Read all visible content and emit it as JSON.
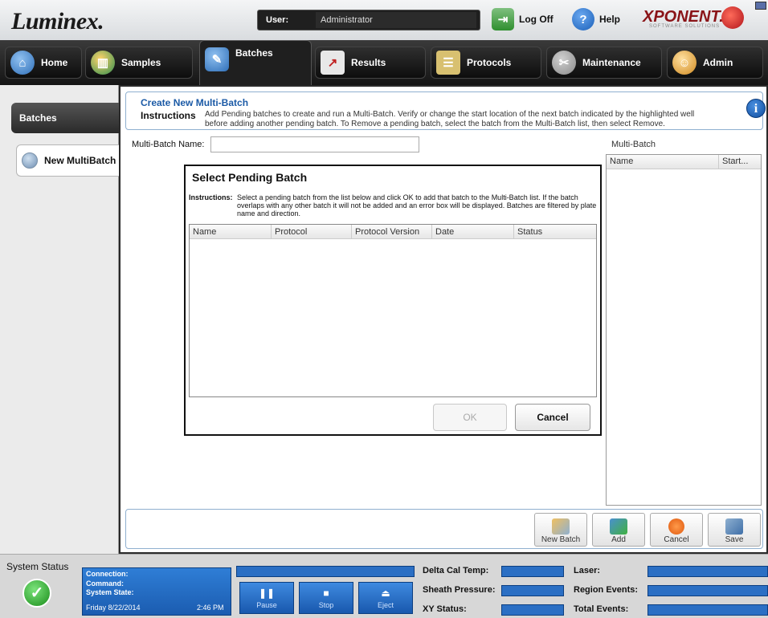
{
  "header": {
    "logo": "Luminex.",
    "user_label": "User:",
    "user_value": "Administrator",
    "logoff_label": "Log Off",
    "help_label": "Help",
    "brand": "XPONENT.",
    "brand_sub": "SOFTWARE SOLUTIONS"
  },
  "nav": {
    "tabs": [
      {
        "label": "Home",
        "icon": "home-icon"
      },
      {
        "label": "Samples",
        "icon": "samples-icon"
      },
      {
        "label": "Batches",
        "icon": "batches-icon"
      },
      {
        "label": "Results",
        "icon": "results-icon"
      },
      {
        "label": "Protocols",
        "icon": "protocols-icon"
      },
      {
        "label": "Maintenance",
        "icon": "maintenance-icon"
      },
      {
        "label": "Admin",
        "icon": "admin-icon"
      }
    ],
    "active": "Batches"
  },
  "left": {
    "section": "Batches",
    "item": "New MultiBatch"
  },
  "main": {
    "title": "Create New Multi-Batch",
    "instructions_label": "Instructions",
    "instructions_text": "Add Pending batches to create and run a Multi-Batch. Verify or change the start location of the next batch indicated by the highlighted well before adding another pending batch. To Remove a pending batch, select the batch from the Multi-Batch list, then select Remove.",
    "multibatch_name_label": "Multi-Batch Name:",
    "multibatch_name_value": "",
    "multibatch_group": "Multi-Batch",
    "multibatch_columns": [
      "Name",
      "Start..."
    ]
  },
  "dialog": {
    "title": "Select Pending Batch",
    "instructions_label": "Instructions:",
    "instructions_text": "Select a pending batch from the list below and click OK to add that batch to the Multi-Batch list. If the batch overlaps with any other batch it will not be added and an error box will be displayed. Batches are filtered by plate name and direction.",
    "columns": [
      "Name",
      "Protocol",
      "Protocol Version",
      "Date",
      "Status"
    ],
    "ok_label": "OK",
    "cancel_label": "Cancel"
  },
  "bottom_buttons": {
    "new_batch": "New Batch",
    "add": "Add",
    "cancel": "Cancel",
    "save": "Save"
  },
  "status": {
    "title": "System Status",
    "connection": "Connection:",
    "command": "Command:",
    "system_state": "System State:",
    "date": "Friday 8/22/2014",
    "time": "2:46 PM",
    "pause": "Pause",
    "stop": "Stop",
    "eject": "Eject",
    "delta_cal_temp": "Delta Cal Temp:",
    "sheath_pressure": "Sheath Pressure:",
    "xy_status": "XY Status:",
    "laser": "Laser:",
    "region_events": "Region Events:",
    "total_events": "Total Events:"
  },
  "colors": {
    "accent": "#1b5aa6",
    "status_blue": "#2b6fc4",
    "ok_green": "#2fae2f"
  }
}
